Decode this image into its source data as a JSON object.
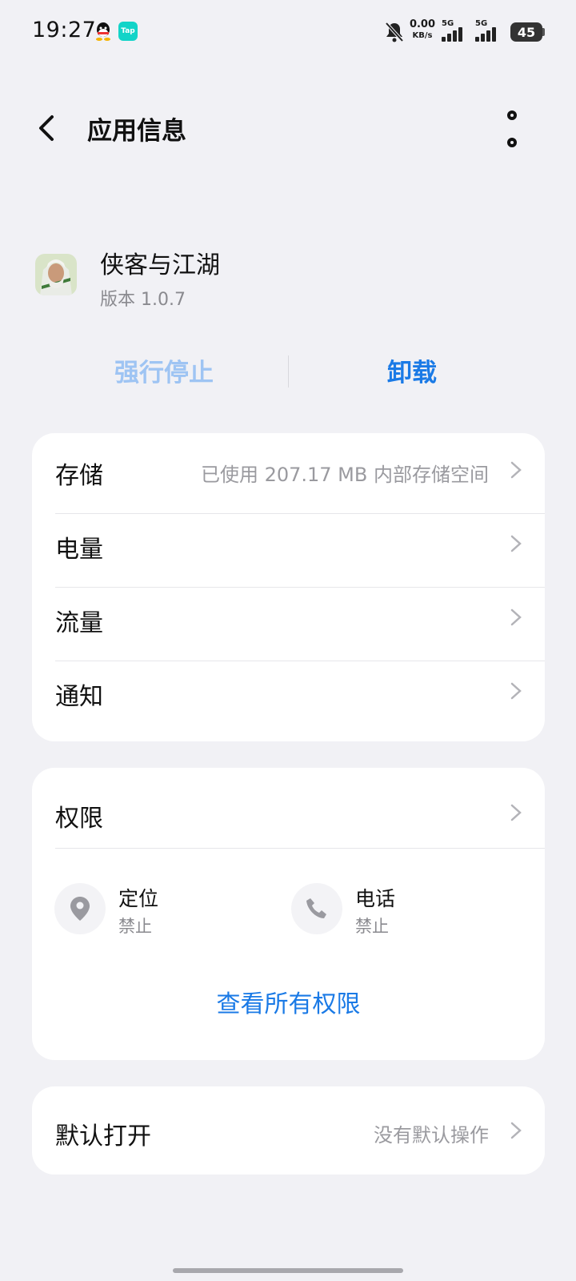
{
  "status_bar": {
    "time": "19:27",
    "tap_label": "Tap",
    "net_speed_value": "0.00",
    "net_speed_unit": "KB/s",
    "sim1_label": "5G",
    "sim2_label": "5G",
    "battery": "45",
    "icons": [
      "qq-icon",
      "taptap-icon",
      "bell-mute-icon",
      "signal-icon",
      "battery-icon"
    ]
  },
  "header": {
    "title": "应用信息",
    "icons": [
      "back-arrow-icon",
      "more-options-icon"
    ]
  },
  "app": {
    "name": "侠客与江湖",
    "version": "版本 1.0.7"
  },
  "actions": {
    "force_stop": "强行停止",
    "uninstall": "卸载"
  },
  "details": [
    {
      "label": "存储",
      "value": "已使用 207.17 MB 内部存储空间"
    },
    {
      "label": "电量",
      "value": ""
    },
    {
      "label": "流量",
      "value": ""
    },
    {
      "label": "通知",
      "value": ""
    }
  ],
  "permissions": {
    "title": "权限",
    "items": [
      {
        "name": "定位",
        "state": "禁止",
        "icon": "location-pin-icon"
      },
      {
        "name": "电话",
        "state": "禁止",
        "icon": "phone-icon"
      }
    ],
    "view_all": "查看所有权限"
  },
  "default_open": {
    "label": "默认打开",
    "value": "没有默认操作"
  },
  "colors": {
    "accent": "#1a7ae6",
    "accent_disabled": "#9ec4f3",
    "background": "#f1f1f5",
    "card": "#ffffff",
    "secondary_text": "#9a9a9f"
  }
}
